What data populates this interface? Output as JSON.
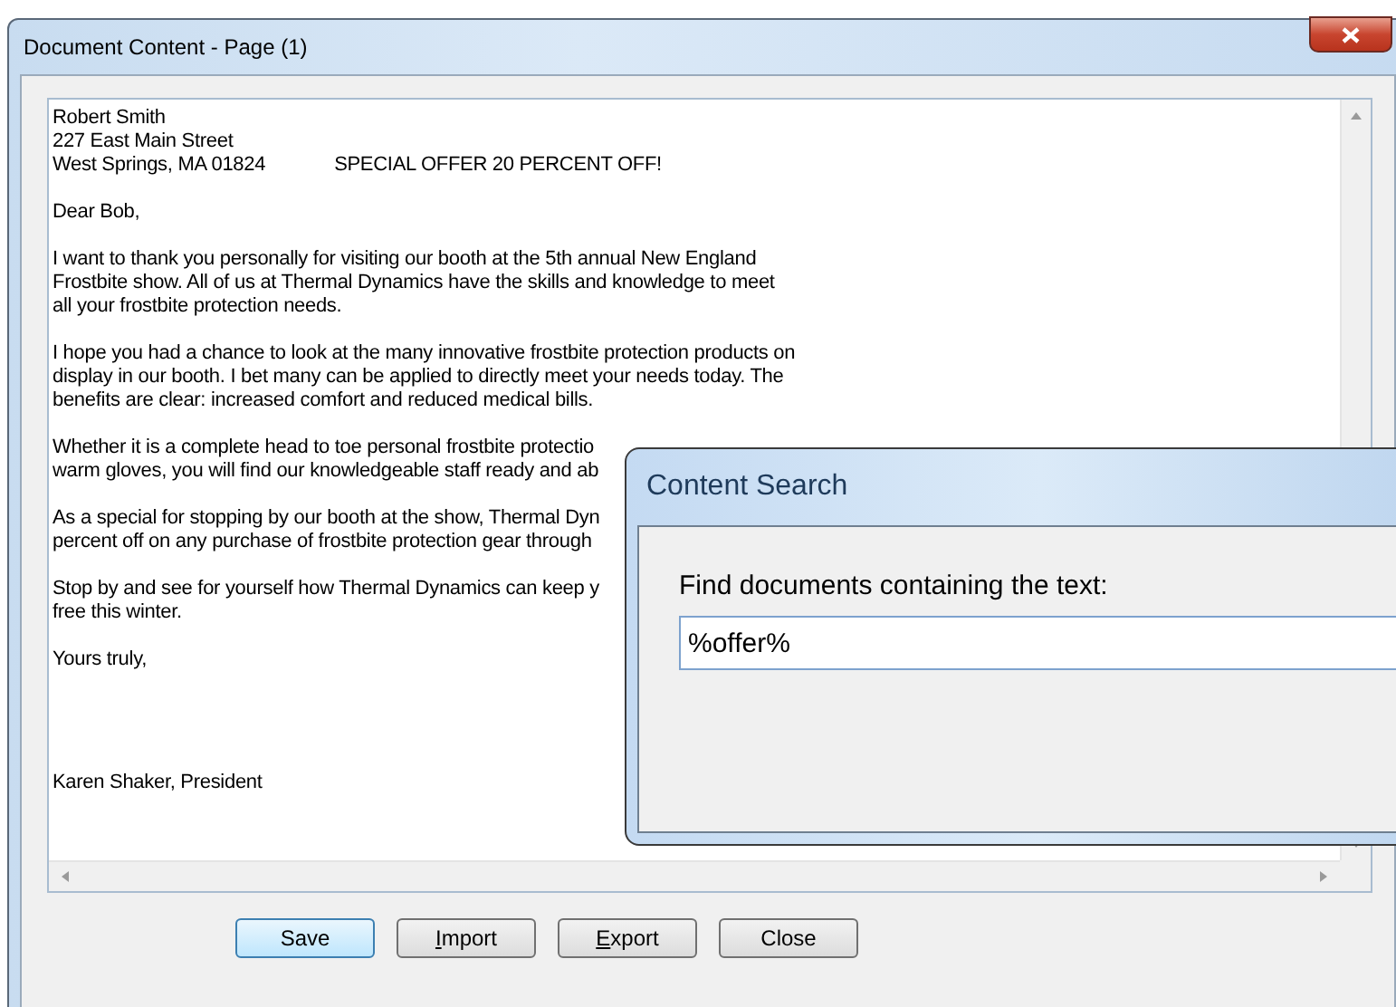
{
  "window": {
    "title": "Document Content - Page (1)"
  },
  "document": {
    "paragraphs": [
      {
        "kind": "body",
        "lines": [
          "Robert Smith",
          "227 East Main Street",
          "West Springs, MA 01824"
        ],
        "aside": "SPECIAL OFFER 20 PERCENT OFF!"
      },
      {
        "kind": "body",
        "lines": [
          "Dear Bob,"
        ]
      },
      {
        "kind": "body",
        "lines": [
          "I want to thank you personally for visiting our booth at the 5th annual New England",
          "Frostbite show. All of us at Thermal Dynamics have the skills and knowledge to meet",
          "all your frostbite protection needs."
        ]
      },
      {
        "kind": "body",
        "lines": [
          "I hope you had a chance to look at the many innovative frostbite protection products on",
          "display in our booth. I bet many can be applied to directly meet your needs today. The",
          "benefits are clear: increased comfort and reduced medical bills."
        ]
      },
      {
        "kind": "body",
        "lines": [
          "Whether it is a complete head to toe personal frostbite protectio",
          "warm gloves, you will find our knowledgeable staff ready and ab"
        ]
      },
      {
        "kind": "body",
        "lines": [
          "As a special for stopping by our booth at the show, Thermal Dyn",
          "percent off on any purchase of frostbite protection gear through"
        ]
      },
      {
        "kind": "body",
        "lines": [
          "Stop by and see for yourself how Thermal Dynamics can keep y",
          "free this winter."
        ]
      },
      {
        "kind": "body",
        "lines": [
          "Yours truly,"
        ]
      },
      {
        "kind": "signature",
        "lines": [
          "Karen Shaker, President"
        ]
      }
    ]
  },
  "buttons": [
    {
      "label": "Save",
      "default": true,
      "access_key": false
    },
    {
      "label": "Import",
      "default": false,
      "access_key": true
    },
    {
      "label": "Export",
      "default": false,
      "access_key": true
    },
    {
      "label": "Close",
      "default": false,
      "access_key": false
    }
  ],
  "search_dialog": {
    "title": "Content Search",
    "label": "Find documents containing the text:",
    "value": "%offer%"
  }
}
